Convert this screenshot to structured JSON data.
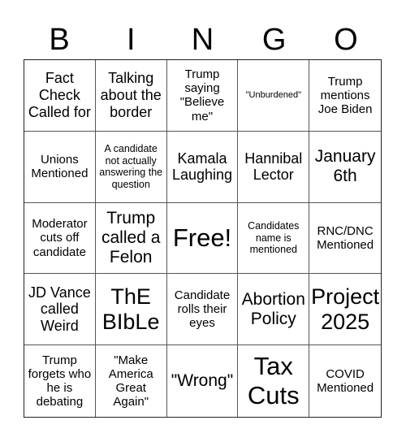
{
  "header": {
    "letters": [
      "B",
      "I",
      "N",
      "G",
      "O"
    ]
  },
  "board": {
    "rows": [
      [
        "Fact Check Called for",
        "Talking about the border",
        "Trump saying \"Believe me\"",
        "\"Unburdened\"",
        "Trump mentions Joe Biden"
      ],
      [
        "Unions Mentioned",
        "A candidate not actually answering the question",
        "Kamala Laughing",
        "Hannibal Lector",
        "January 6th"
      ],
      [
        "Moderator cuts off candidate",
        "Trump called a Felon",
        "Free!",
        "Candidates name is mentioned",
        "RNC/DNC Mentioned"
      ],
      [
        "JD Vance called Weird",
        "ThE BIbLe",
        "Candidate rolls their eyes",
        "Abortion Policy",
        "Project 2025"
      ],
      [
        "Trump forgets who he is debating",
        "\"Make America Great Again\"",
        "\"Wrong\"",
        "Tax Cuts",
        "COVID Mentioned"
      ]
    ]
  }
}
